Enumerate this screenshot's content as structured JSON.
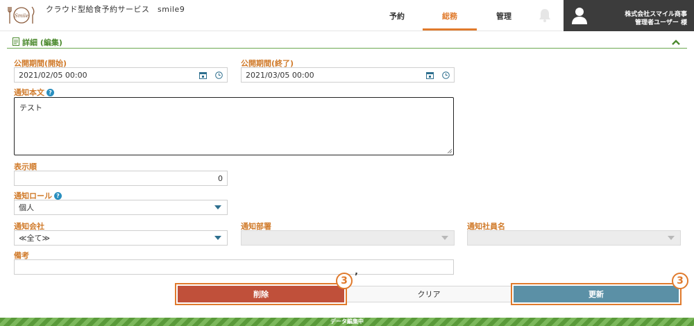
{
  "header": {
    "logo_text": "Smile",
    "app_title": "クラウド型給食予約サービス　smile9",
    "tabs": [
      {
        "label": "予約",
        "active": false
      },
      {
        "label": "総務",
        "active": true
      },
      {
        "label": "管理",
        "active": false
      }
    ],
    "user": {
      "company": "株式会社スマイル商事",
      "name": "管理者ユーザー 様"
    }
  },
  "section": {
    "title": "詳細 (編集)"
  },
  "form": {
    "start": {
      "label": "公開期間(開始)",
      "value": "2021/02/05 00:00"
    },
    "end": {
      "label": "公開期間(終了)",
      "value": "2021/03/05 00:00"
    },
    "body": {
      "label": "通知本文",
      "value": "テスト"
    },
    "order": {
      "label": "表示順",
      "value": "0"
    },
    "role": {
      "label": "通知ロール",
      "value": "個人"
    },
    "company": {
      "label": "通知会社",
      "value": "≪全て≫"
    },
    "department": {
      "label": "通知部署",
      "value": ""
    },
    "employee": {
      "label": "通知社員名",
      "value": ""
    },
    "remarks": {
      "label": "備考",
      "value": ""
    }
  },
  "buttons": {
    "delete": "削除",
    "clear": "クリア",
    "update": "更新"
  },
  "annotations": {
    "delete_badge": "3",
    "delete_mark": "’",
    "update_badge": "3"
  },
  "footer": {
    "status": "データ編集中"
  },
  "colors": {
    "accent_orange": "#e07a2c",
    "label_orange": "#d07a2a",
    "section_green": "#4c8a2e",
    "delete_red": "#c0503a",
    "update_blue": "#5b90a6",
    "user_bg": "#3c3c3c"
  }
}
